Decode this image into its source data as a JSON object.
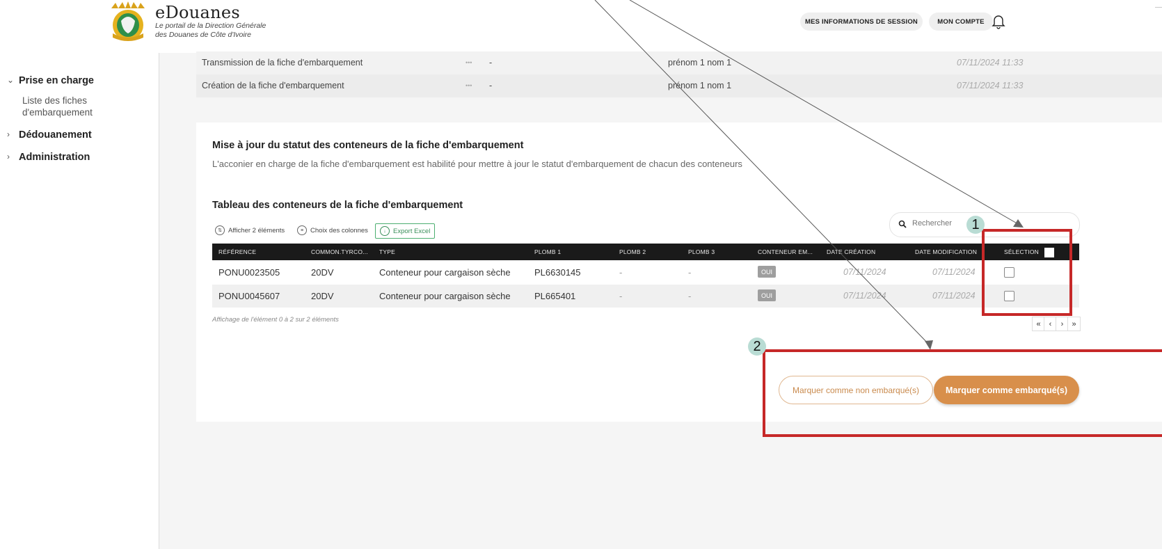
{
  "header": {
    "brand_title": "eDouanes",
    "brand_subtitle_line1": "Le portail de la Direction Générale",
    "brand_subtitle_line2": "des Douanes de Côte d'Ivoire",
    "session_button": "MES INFORMATIONS DE SESSION",
    "account_button": "MON COMPTE",
    "bell_icon": "bell-icon"
  },
  "sidebar": {
    "items": [
      {
        "label": "Prise en charge",
        "expanded": true,
        "chevron": "⌄"
      },
      {
        "label": "Dédouanement",
        "expanded": false,
        "chevron": "›"
      },
      {
        "label": "Administration",
        "expanded": false,
        "chevron": "›"
      }
    ],
    "subitem": "Liste des fiches d'embarquement"
  },
  "history": [
    {
      "action": "Transmission de la fiche d'embarquement",
      "dots": "•••",
      "value": "-",
      "user": "prénom 1 nom 1",
      "date": "07/11/2024 11:33"
    },
    {
      "action": "Création de la fiche d'embarquement",
      "dots": "•••",
      "value": "-",
      "user": "prénom 1 nom 1",
      "date": "07/11/2024 11:33"
    }
  ],
  "section": {
    "title": "Mise à jour du statut des conteneurs de la fiche d'embarquement",
    "description": "L'acconier en charge de la fiche d'embarquement est habilité pour mettre à jour le statut d'embarquement de chacun des conteneurs"
  },
  "table": {
    "title": "Tableau des conteneurs de la fiche d'embarquement",
    "tools": {
      "show_count": "Afficher 2 éléments",
      "columns": "Choix des colonnes",
      "export": "Export Excel"
    },
    "search_placeholder": "Rechercher",
    "headers": [
      "RÉFÉRENCE",
      "COMMON.TYRCO...",
      "TYPE",
      "PLOMB 1",
      "PLOMB 2",
      "PLOMB 3",
      "CONTENEUR EM...",
      "DATE CRÉATION",
      "DATE MODIFICATION",
      "SÉLECTION"
    ],
    "rows": [
      {
        "ref": "PONU0023505",
        "tyrco": "20DV",
        "type": "Conteneur pour cargaison sèche",
        "plomb1": "PL6630145",
        "plomb2": "-",
        "plomb3": "-",
        "embarque": "OUI",
        "created": "07/11/2024",
        "modified": "07/11/2024"
      },
      {
        "ref": "PONU0045607",
        "tyrco": "20DV",
        "type": "Conteneur pour cargaison sèche",
        "plomb1": "PL665401",
        "plomb2": "-",
        "plomb3": "-",
        "embarque": "OUI",
        "created": "07/11/2024",
        "modified": "07/11/2024"
      }
    ],
    "footer": "Affichage de l'élément 0 à 2 sur 2 éléments",
    "pager": [
      "«",
      "‹",
      "›",
      "»"
    ]
  },
  "actions": {
    "mark_not_boarded": "Marquer comme non embarqué(s)",
    "mark_boarded": "Marquer comme embarqué(s)"
  },
  "annotations": {
    "one": "1",
    "two": "2",
    "color": "#c62828"
  }
}
